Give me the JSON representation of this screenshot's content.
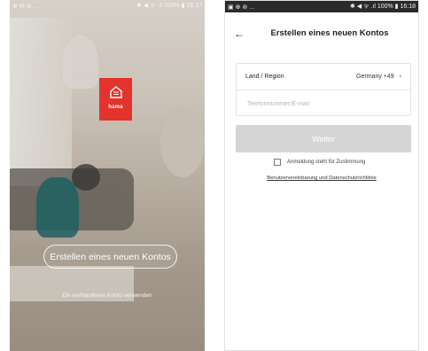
{
  "left_screen": {
    "status_bar": {
      "left": "⊕ ✉ ⊚ ...",
      "right": "✱ ◀ ᯤ .ıl 100% ▮ 16:17"
    },
    "logo_text": "hama",
    "create_button": "Erstellen eines neuen Kontos",
    "existing_account_link": "Ein vorhandenes Konto verwenden",
    "colors": {
      "logo": "#e2342c"
    }
  },
  "right_screen": {
    "status_bar": {
      "left": "▣ ⊕ ⊚ ...",
      "right": "✱ ◀ ᯤ .ıl 100% ▮ 16:18"
    },
    "back_icon": "arrow-left-icon",
    "title": "Erstellen eines neuen Kontos",
    "region_label": "Land / Region",
    "region_value": "Germany +49",
    "region_chevron": "›",
    "phone_placeholder": "Telefonnummer/E-mail",
    "next_button": "Weiter",
    "consent_text": "Anmeldung steht für Zustimmung",
    "terms_link": "Benutzervereinbarung und Datenschutzrichtlinie",
    "colors": {
      "button_disabled": "#d5d5d5"
    }
  }
}
